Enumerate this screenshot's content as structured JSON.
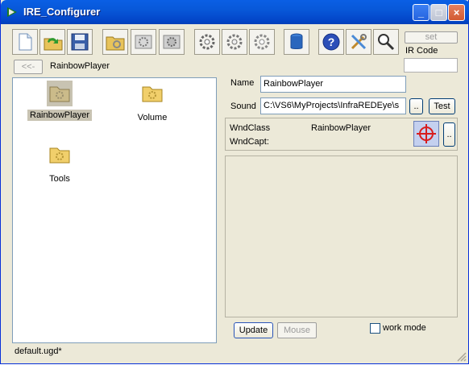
{
  "window": {
    "title": "IRE_Configurer"
  },
  "toolbar": {
    "icons": [
      "new-file-icon",
      "open-refresh-icon",
      "save-disk-icon",
      "folder-gear-icon",
      "gear-frame-icon",
      "gear-grey-icon",
      "gear-large-icon",
      "gear-medium-icon",
      "gear-outline-icon",
      "cylinder-icon",
      "help-icon",
      "tools-icon",
      "magnifier-icon"
    ],
    "set_label": "set",
    "ir_code_label": "IR Code",
    "ir_code_value": ""
  },
  "nav": {
    "back_label": "<<-",
    "path": "RainbowPlayer"
  },
  "tree": {
    "items": [
      {
        "label": "RainbowPlayer",
        "selected": true
      },
      {
        "label": "Volume",
        "selected": false
      },
      {
        "label": "Tools",
        "selected": false
      }
    ]
  },
  "form": {
    "name_label": "Name",
    "name_value": "RainbowPlayer",
    "sound_label": "Sound",
    "sound_value": "C:\\VS6\\MyProjects\\InfraREDEye\\s",
    "browse_label": "..",
    "test_label": "Test"
  },
  "window_info": {
    "wndclass_label": "WndClass",
    "wndclass_value": "RainbowPlayer",
    "wndcapt_label": "WndCapt:",
    "wndcapt_value": "",
    "more_label": ".."
  },
  "actions": {
    "update_label": "Update",
    "mouse_label": "Mouse",
    "workmode_label": "work mode",
    "workmode_checked": false
  },
  "status": {
    "file": "default.ugd*"
  }
}
